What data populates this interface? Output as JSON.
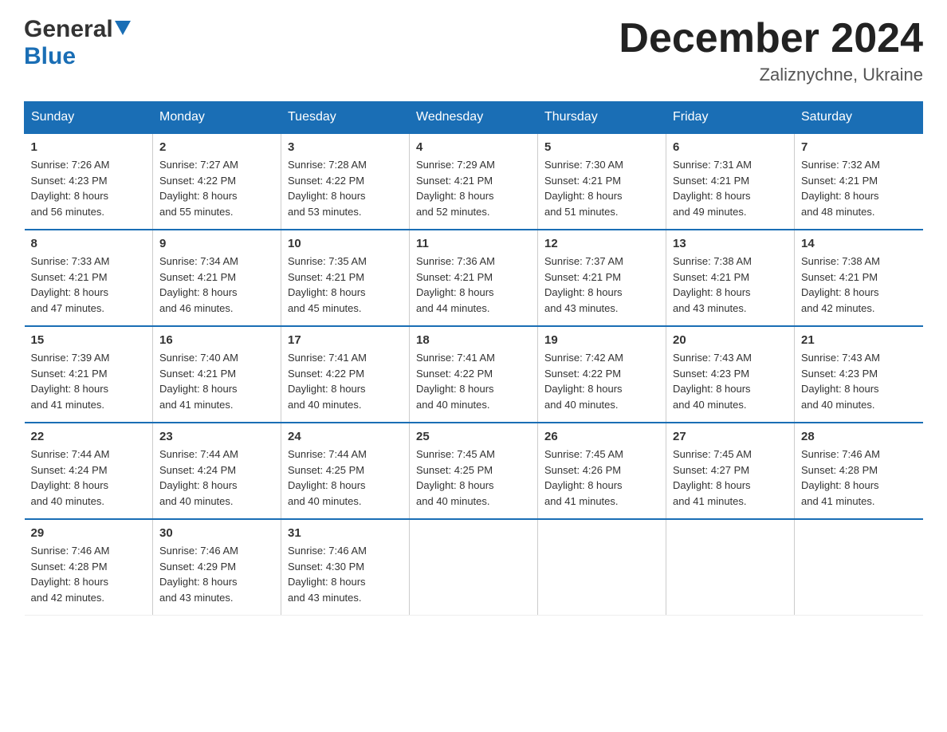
{
  "header": {
    "logo_general": "General",
    "logo_blue": "Blue",
    "month_title": "December 2024",
    "location": "Zaliznychne, Ukraine"
  },
  "days_of_week": [
    "Sunday",
    "Monday",
    "Tuesday",
    "Wednesday",
    "Thursday",
    "Friday",
    "Saturday"
  ],
  "weeks": [
    [
      {
        "day": "1",
        "sunrise": "7:26 AM",
        "sunset": "4:23 PM",
        "daylight": "8 hours and 56 minutes."
      },
      {
        "day": "2",
        "sunrise": "7:27 AM",
        "sunset": "4:22 PM",
        "daylight": "8 hours and 55 minutes."
      },
      {
        "day": "3",
        "sunrise": "7:28 AM",
        "sunset": "4:22 PM",
        "daylight": "8 hours and 53 minutes."
      },
      {
        "day": "4",
        "sunrise": "7:29 AM",
        "sunset": "4:21 PM",
        "daylight": "8 hours and 52 minutes."
      },
      {
        "day": "5",
        "sunrise": "7:30 AM",
        "sunset": "4:21 PM",
        "daylight": "8 hours and 51 minutes."
      },
      {
        "day": "6",
        "sunrise": "7:31 AM",
        "sunset": "4:21 PM",
        "daylight": "8 hours and 49 minutes."
      },
      {
        "day": "7",
        "sunrise": "7:32 AM",
        "sunset": "4:21 PM",
        "daylight": "8 hours and 48 minutes."
      }
    ],
    [
      {
        "day": "8",
        "sunrise": "7:33 AM",
        "sunset": "4:21 PM",
        "daylight": "8 hours and 47 minutes."
      },
      {
        "day": "9",
        "sunrise": "7:34 AM",
        "sunset": "4:21 PM",
        "daylight": "8 hours and 46 minutes."
      },
      {
        "day": "10",
        "sunrise": "7:35 AM",
        "sunset": "4:21 PM",
        "daylight": "8 hours and 45 minutes."
      },
      {
        "day": "11",
        "sunrise": "7:36 AM",
        "sunset": "4:21 PM",
        "daylight": "8 hours and 44 minutes."
      },
      {
        "day": "12",
        "sunrise": "7:37 AM",
        "sunset": "4:21 PM",
        "daylight": "8 hours and 43 minutes."
      },
      {
        "day": "13",
        "sunrise": "7:38 AM",
        "sunset": "4:21 PM",
        "daylight": "8 hours and 43 minutes."
      },
      {
        "day": "14",
        "sunrise": "7:38 AM",
        "sunset": "4:21 PM",
        "daylight": "8 hours and 42 minutes."
      }
    ],
    [
      {
        "day": "15",
        "sunrise": "7:39 AM",
        "sunset": "4:21 PM",
        "daylight": "8 hours and 41 minutes."
      },
      {
        "day": "16",
        "sunrise": "7:40 AM",
        "sunset": "4:21 PM",
        "daylight": "8 hours and 41 minutes."
      },
      {
        "day": "17",
        "sunrise": "7:41 AM",
        "sunset": "4:22 PM",
        "daylight": "8 hours and 40 minutes."
      },
      {
        "day": "18",
        "sunrise": "7:41 AM",
        "sunset": "4:22 PM",
        "daylight": "8 hours and 40 minutes."
      },
      {
        "day": "19",
        "sunrise": "7:42 AM",
        "sunset": "4:22 PM",
        "daylight": "8 hours and 40 minutes."
      },
      {
        "day": "20",
        "sunrise": "7:43 AM",
        "sunset": "4:23 PM",
        "daylight": "8 hours and 40 minutes."
      },
      {
        "day": "21",
        "sunrise": "7:43 AM",
        "sunset": "4:23 PM",
        "daylight": "8 hours and 40 minutes."
      }
    ],
    [
      {
        "day": "22",
        "sunrise": "7:44 AM",
        "sunset": "4:24 PM",
        "daylight": "8 hours and 40 minutes."
      },
      {
        "day": "23",
        "sunrise": "7:44 AM",
        "sunset": "4:24 PM",
        "daylight": "8 hours and 40 minutes."
      },
      {
        "day": "24",
        "sunrise": "7:44 AM",
        "sunset": "4:25 PM",
        "daylight": "8 hours and 40 minutes."
      },
      {
        "day": "25",
        "sunrise": "7:45 AM",
        "sunset": "4:25 PM",
        "daylight": "8 hours and 40 minutes."
      },
      {
        "day": "26",
        "sunrise": "7:45 AM",
        "sunset": "4:26 PM",
        "daylight": "8 hours and 41 minutes."
      },
      {
        "day": "27",
        "sunrise": "7:45 AM",
        "sunset": "4:27 PM",
        "daylight": "8 hours and 41 minutes."
      },
      {
        "day": "28",
        "sunrise": "7:46 AM",
        "sunset": "4:28 PM",
        "daylight": "8 hours and 41 minutes."
      }
    ],
    [
      {
        "day": "29",
        "sunrise": "7:46 AM",
        "sunset": "4:28 PM",
        "daylight": "8 hours and 42 minutes."
      },
      {
        "day": "30",
        "sunrise": "7:46 AM",
        "sunset": "4:29 PM",
        "daylight": "8 hours and 43 minutes."
      },
      {
        "day": "31",
        "sunrise": "7:46 AM",
        "sunset": "4:30 PM",
        "daylight": "8 hours and 43 minutes."
      },
      null,
      null,
      null,
      null
    ]
  ]
}
